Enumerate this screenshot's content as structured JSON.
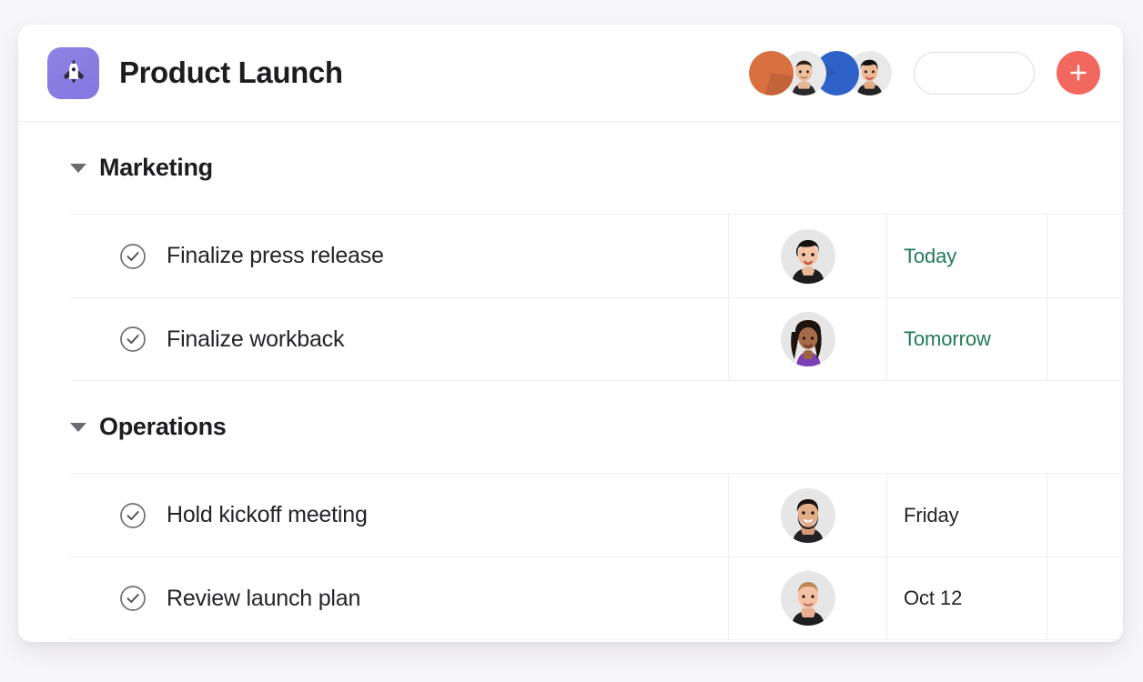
{
  "header": {
    "app_icon": "rocket-icon",
    "title": "Product Launch",
    "member_avatars": [
      {
        "name": "member-avatar-1",
        "bg": "#d9703f"
      },
      {
        "name": "member-avatar-2",
        "bg": "#e6e6e6"
      },
      {
        "name": "member-avatar-3",
        "bg": "#2f62c8"
      },
      {
        "name": "member-avatar-4",
        "bg": "#e6e6e6"
      }
    ],
    "filter_pill_label": "",
    "add_button_label": "+",
    "add_button_color": "#f2685f"
  },
  "colors": {
    "accent_purple": "#8477df",
    "accent_red": "#f2685f",
    "date_due_soon": "#1f7a57",
    "text_primary": "#1d1c1f",
    "divider": "#efeef0"
  },
  "sections": [
    {
      "name": "Marketing",
      "expanded": true,
      "caret": "chevron-down-icon",
      "tasks": [
        {
          "check_icon": "check-circle-icon",
          "title": "Finalize press release",
          "assignee_avatar": "assignee-avatar-asian-woman",
          "due": "Today",
          "due_highlight": true
        },
        {
          "check_icon": "check-circle-icon",
          "title": "Finalize workback",
          "assignee_avatar": "assignee-avatar-black-woman",
          "due": "Tomorrow",
          "due_highlight": true
        }
      ]
    },
    {
      "name": "Operations",
      "expanded": true,
      "caret": "chevron-down-icon",
      "tasks": [
        {
          "check_icon": "check-circle-icon",
          "title": "Hold kickoff meeting",
          "assignee_avatar": "assignee-avatar-bearded-man",
          "due": "Friday",
          "due_highlight": false
        },
        {
          "check_icon": "check-circle-icon",
          "title": "Review launch plan",
          "assignee_avatar": "assignee-avatar-blond-man",
          "due": "Oct 12",
          "due_highlight": false
        }
      ]
    }
  ]
}
